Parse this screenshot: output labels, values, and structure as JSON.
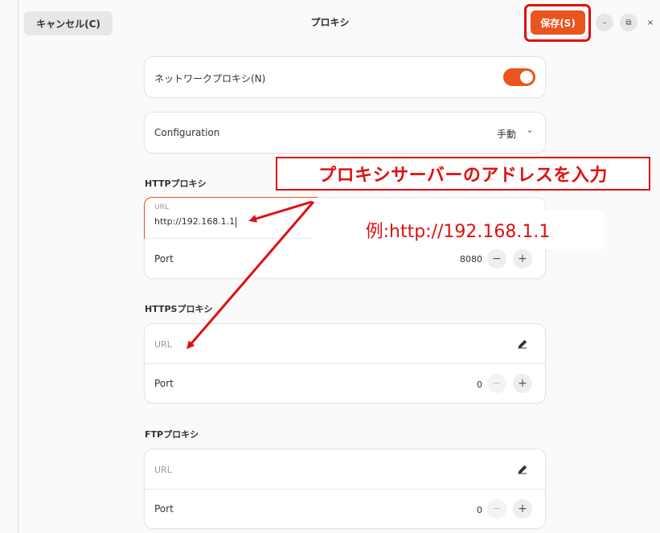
{
  "header": {
    "cancel_label": "キャンセル(C)",
    "title": "プロキシ",
    "save_label": "保存(S)",
    "minimize": "–",
    "restore": "⧉",
    "close": "×"
  },
  "network_proxy": {
    "label": "ネットワークプロキシ(N)",
    "enabled": true
  },
  "configuration": {
    "label": "Configuration",
    "value": "手動",
    "chevron": "⌄"
  },
  "http": {
    "section_label": "HTTPプロキシ",
    "url_label": "URL",
    "url_value": "http://192.168.1.1",
    "port_label": "Port",
    "port_value": "8080"
  },
  "https": {
    "section_label": "HTTPSプロキシ",
    "url_placeholder": "URL",
    "port_label": "Port",
    "port_value": "0"
  },
  "ftp": {
    "section_label": "FTPプロキシ",
    "url_placeholder": "URL",
    "port_label": "Port",
    "port_value": "0"
  },
  "stepper": {
    "minus": "−",
    "plus": "+"
  },
  "annotations": {
    "callout": "プロキシサーバーのアドレスを入力",
    "example": "例:http://192.168.1.1",
    "color": "#e01010"
  },
  "colors": {
    "accent": "#e9541f"
  }
}
